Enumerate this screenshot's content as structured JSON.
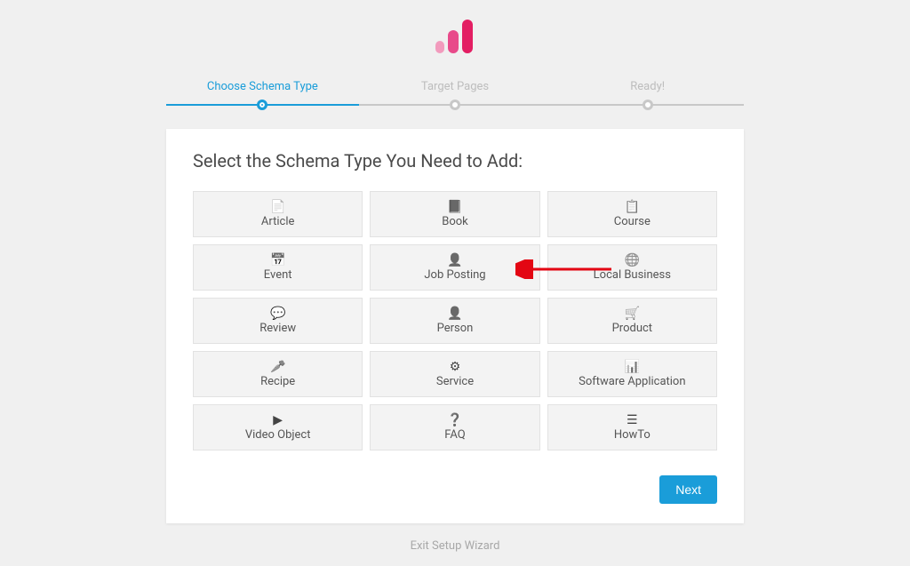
{
  "progress": {
    "steps": [
      "Choose Schema Type",
      "Target Pages",
      "Ready!"
    ],
    "active_index": 0
  },
  "card": {
    "title": "Select the Schema Type You Need to Add:",
    "tiles": [
      {
        "label": "Article",
        "icon": "file-icon"
      },
      {
        "label": "Book",
        "icon": "book-icon"
      },
      {
        "label": "Course",
        "icon": "clipboard-icon"
      },
      {
        "label": "Event",
        "icon": "calendar-icon"
      },
      {
        "label": "Job Posting",
        "icon": "user-plus-icon"
      },
      {
        "label": "Local Business",
        "icon": "globe-icon"
      },
      {
        "label": "Review",
        "icon": "comment-icon"
      },
      {
        "label": "Person",
        "icon": "user-icon"
      },
      {
        "label": "Product",
        "icon": "cart-icon"
      },
      {
        "label": "Recipe",
        "icon": "carrot-icon"
      },
      {
        "label": "Service",
        "icon": "gear-icon"
      },
      {
        "label": "Software Application",
        "icon": "dashboard-icon"
      },
      {
        "label": "Video Object",
        "icon": "play-icon"
      },
      {
        "label": "FAQ",
        "icon": "question-icon"
      },
      {
        "label": "HowTo",
        "icon": "list-icon"
      }
    ]
  },
  "buttons": {
    "next": "Next",
    "exit": "Exit Setup Wizard"
  },
  "annotation": {
    "arrow_target_tile_index": 4,
    "arrow_color": "#e30613"
  },
  "brand": {
    "pink_light": "#f29bbd",
    "pink_mid": "#e84a8a",
    "pink_dark": "#e31e63",
    "step_active": "#1a9dd9"
  }
}
